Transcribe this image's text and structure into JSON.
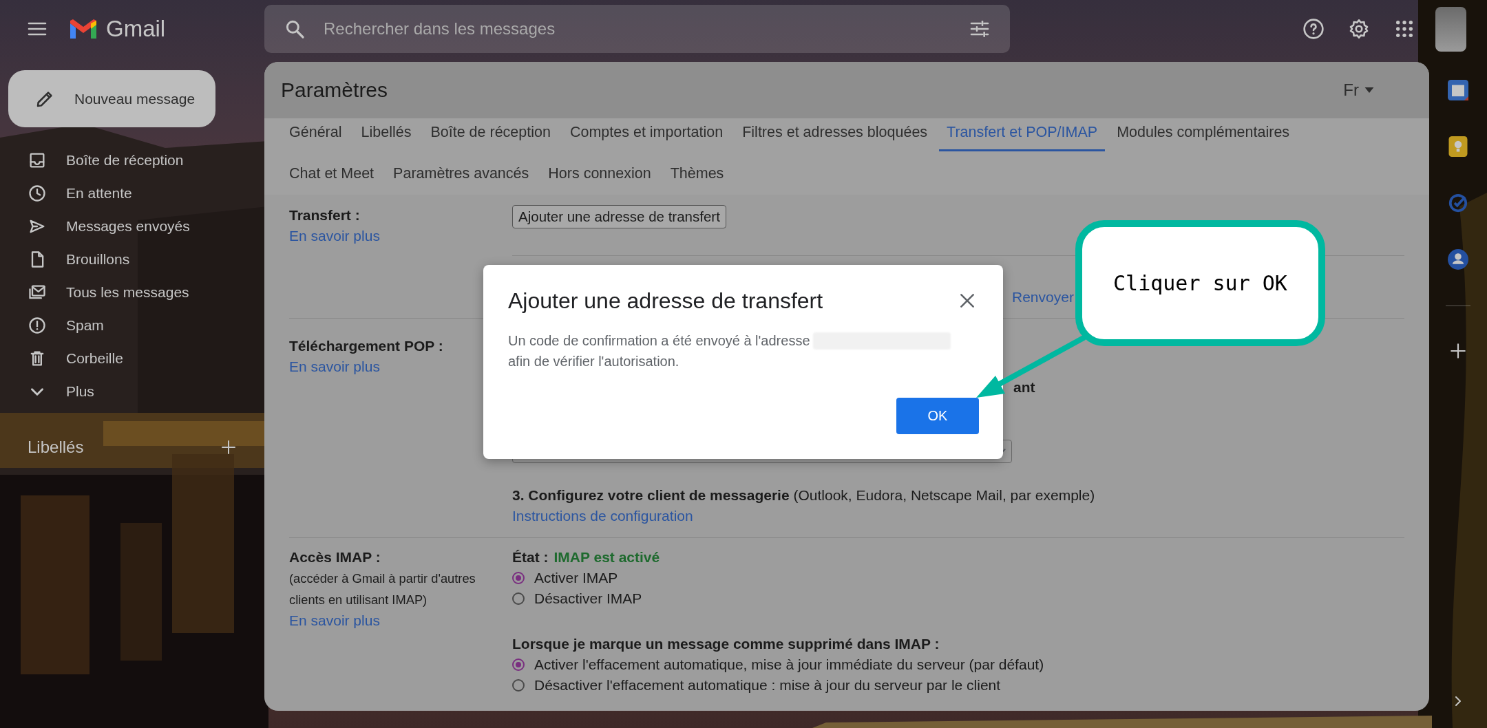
{
  "header": {
    "app_name": "Gmail",
    "search": {
      "placeholder": "Rechercher dans les messages"
    }
  },
  "sidebar": {
    "compose": "Nouveau message",
    "items": [
      {
        "label": "Boîte de réception",
        "selected": false
      },
      {
        "label": "En attente",
        "selected": false
      },
      {
        "label": "Messages envoyés",
        "selected": false
      },
      {
        "label": "Brouillons",
        "selected": false
      },
      {
        "label": "Tous les messages",
        "selected": false
      },
      {
        "label": "Spam",
        "selected": false
      },
      {
        "label": "Corbeille",
        "selected": false
      },
      {
        "label": "Plus",
        "selected": false
      }
    ],
    "labels_heading": "Libellés"
  },
  "settings": {
    "title": "Paramètres",
    "input_tool": "Fr",
    "tab_rows": [
      [
        {
          "label": "Général",
          "selected": false
        },
        {
          "label": "Libellés",
          "selected": false
        },
        {
          "label": "Boîte de réception",
          "selected": false
        },
        {
          "label": "Comptes et importation",
          "selected": false
        },
        {
          "label": "Filtres et adresses bloquées",
          "selected": false
        },
        {
          "label": "Transfert et POP/IMAP",
          "selected": true
        },
        {
          "label": "Modules complémentaires",
          "selected": false
        }
      ],
      [
        {
          "label": "Chat et Meet",
          "selected": false
        },
        {
          "label": "Paramètres avancés",
          "selected": false
        },
        {
          "label": "Hors connexion",
          "selected": false
        },
        {
          "label": "Thèmes",
          "selected": false
        }
      ]
    ],
    "forwarding": {
      "label": "Transfert :",
      "learn_more": "En savoir plus",
      "add_button": "Ajouter une adresse de transfert",
      "resend_link": "Renvoyer"
    },
    "pop": {
      "label": "Téléchargement POP :",
      "learn_more": "En savoir plus",
      "step_fragment": "ant",
      "step_3": "**3. Configurez votre client de messagerie** (Outlook, Eudora, Netscape Mail, par exemple)",
      "config_link": "Instructions de configuration"
    },
    "imap": {
      "label": "Accès IMAP :",
      "description": "(accéder à Gmail à partir d'autres clients en utilisant IMAP)",
      "learn_more": "En savoir plus",
      "status_label": "État :",
      "status_value": "IMAP est activé",
      "options": [
        {
          "label": "Activer IMAP",
          "selected": true
        },
        {
          "label": "Désactiver IMAP",
          "selected": false
        }
      ],
      "delete_heading": "Lorsque je marque un message comme supprimé dans IMAP :",
      "delete_options": [
        {
          "label": "Activer l'effacement automatique, mise à jour immédiate du serveur (par défaut)",
          "selected": true
        },
        {
          "label": "Désactiver l'effacement automatique : mise à jour du serveur par le client",
          "selected": false
        }
      ]
    }
  },
  "dialog": {
    "title": "Ajouter une adresse de transfert",
    "message_start": "Un code de confirmation a été envoyé à l'adresse",
    "message_end": "afin de vérifier l'autorisation.",
    "ok_button": "OK"
  },
  "callout": {
    "text": "Cliquer sur OK"
  }
}
